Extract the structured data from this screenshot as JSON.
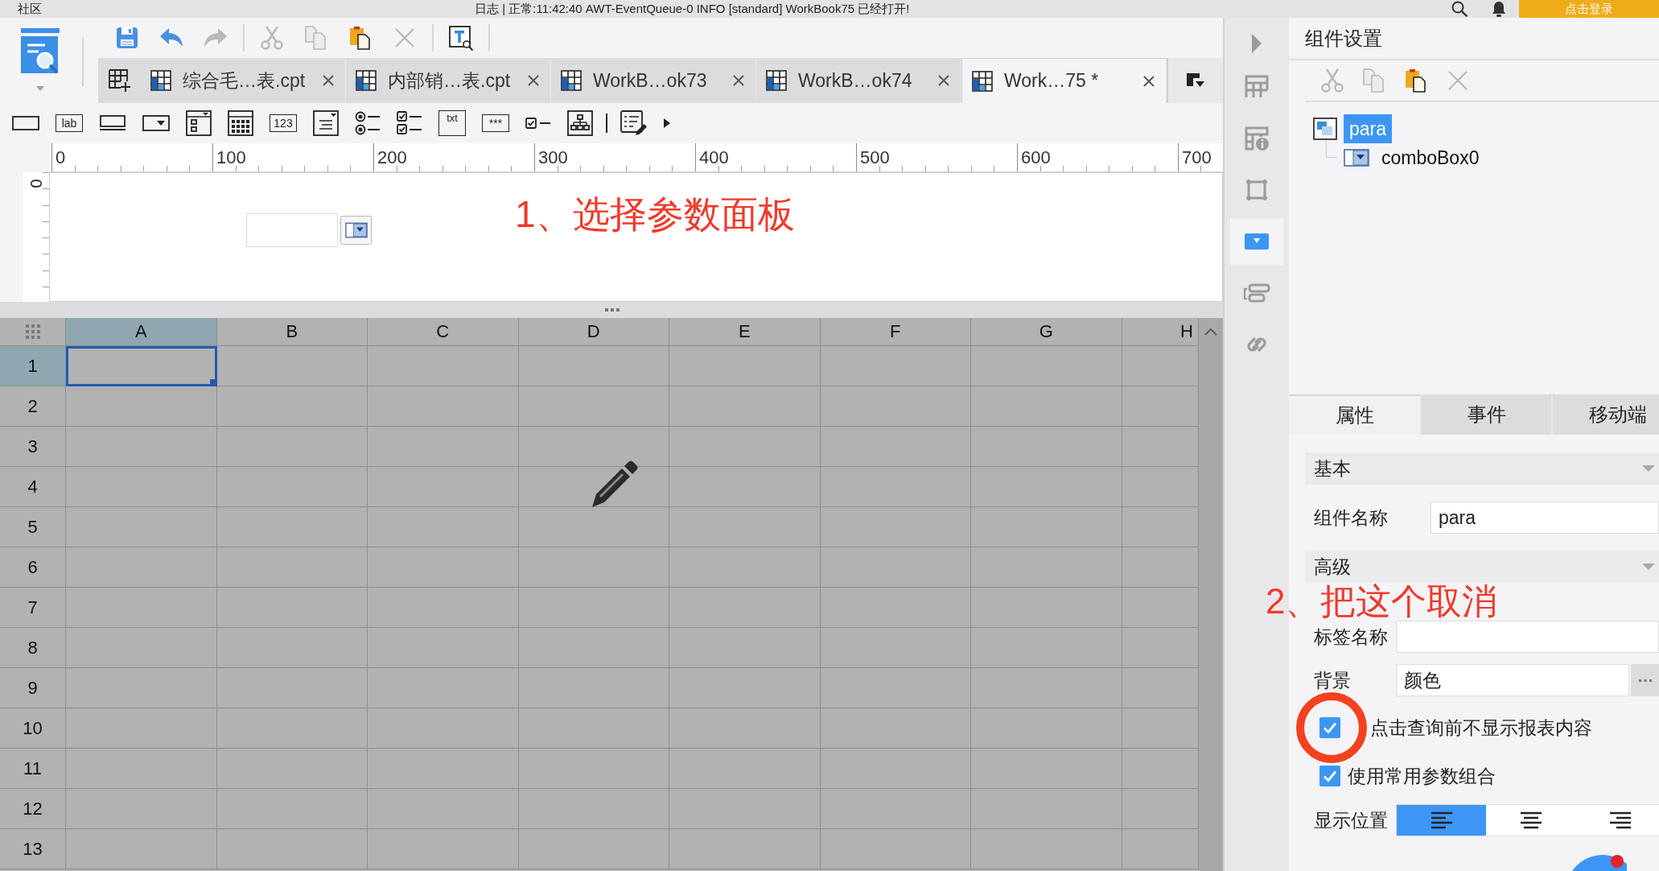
{
  "top_bar": {
    "community": "社区",
    "log_text": "日志 | 正常:11:42:40 AWT-EventQueue-0 INFO [standard] WorkBook75 已经打开!",
    "login_button": "点击登录"
  },
  "toolbar": {
    "groups": [
      [
        {
          "kind": "save",
          "disabled": false
        },
        {
          "kind": "undo",
          "disabled": false
        },
        {
          "kind": "redo",
          "disabled": true
        }
      ],
      [
        {
          "kind": "cut",
          "disabled": true
        },
        {
          "kind": "copy",
          "disabled": true
        },
        {
          "kind": "paste",
          "disabled": false
        },
        {
          "kind": "delete",
          "disabled": true
        }
      ],
      [
        {
          "kind": "text-search",
          "disabled": false
        }
      ]
    ]
  },
  "document_tabs": [
    {
      "label": "综合毛…表.cpt",
      "selected": false
    },
    {
      "label": "内部销…表.cpt",
      "selected": false
    },
    {
      "label": "WorkB…ok73",
      "selected": false
    },
    {
      "label": "WorkB…ok74",
      "selected": false
    },
    {
      "label": "Work…75 *",
      "selected": true
    }
  ],
  "widget_palette": [
    {
      "kind": "button"
    },
    {
      "kind": "label",
      "text": "lab"
    },
    {
      "kind": "text-field"
    },
    {
      "kind": "combo-box"
    },
    {
      "kind": "tree-combo"
    },
    {
      "kind": "date"
    },
    {
      "kind": "number",
      "text": "123"
    },
    {
      "kind": "list"
    },
    {
      "kind": "radio-group"
    },
    {
      "kind": "checkbox-group"
    },
    {
      "kind": "text-area",
      "text": "txt"
    },
    {
      "kind": "password",
      "text": "***"
    },
    {
      "kind": "checkbox"
    },
    {
      "kind": "tree"
    },
    {
      "kind": "separator"
    },
    {
      "kind": "form-edit"
    },
    {
      "kind": "more"
    }
  ],
  "ruler": {
    "horizontal_labels": [
      "0",
      "100",
      "200",
      "300",
      "400",
      "500",
      "600",
      "700"
    ],
    "vertical_label": "0"
  },
  "parameter_panel": {
    "annotation": "1、选择参数面板"
  },
  "sheet": {
    "columns": [
      {
        "label": "A",
        "selected": true
      },
      {
        "label": "B",
        "selected": false
      },
      {
        "label": "C",
        "selected": false
      },
      {
        "label": "D",
        "selected": false
      },
      {
        "label": "E",
        "selected": false
      },
      {
        "label": "F",
        "selected": false
      },
      {
        "label": "G",
        "selected": false
      },
      {
        "label": "H",
        "selected": false
      }
    ],
    "rows": [
      {
        "label": "1",
        "selected": true
      },
      {
        "label": "2",
        "selected": false
      },
      {
        "label": "3",
        "selected": false
      },
      {
        "label": "4",
        "selected": false
      },
      {
        "label": "5",
        "selected": false
      },
      {
        "label": "6",
        "selected": false
      },
      {
        "label": "7",
        "selected": false
      },
      {
        "label": "8",
        "selected": false
      },
      {
        "label": "9",
        "selected": false
      },
      {
        "label": "10",
        "selected": false
      },
      {
        "label": "11",
        "selected": false
      },
      {
        "label": "12",
        "selected": false
      },
      {
        "label": "13",
        "selected": false
      }
    ]
  },
  "side_toolbar": [
    {
      "kind": "table",
      "selected": false
    },
    {
      "kind": "table-info",
      "selected": false
    },
    {
      "kind": "frame",
      "selected": false
    },
    {
      "kind": "widget",
      "selected": true
    },
    {
      "kind": "form-layout",
      "selected": false
    },
    {
      "kind": "link",
      "selected": false
    }
  ],
  "settings_panel": {
    "title": "组件设置",
    "toolbar": [
      {
        "kind": "cut",
        "disabled": true
      },
      {
        "kind": "copy",
        "disabled": true
      },
      {
        "kind": "paste",
        "disabled": false
      },
      {
        "kind": "delete",
        "disabled": true
      }
    ],
    "tree": [
      {
        "label": "para",
        "kind": "panel",
        "selected": true,
        "children": [
          {
            "label": "comboBox0",
            "kind": "combo-box",
            "selected": false
          }
        ]
      }
    ],
    "tabs": [
      {
        "label": "属性",
        "selected": true
      },
      {
        "label": "事件",
        "selected": false
      },
      {
        "label": "移动端",
        "selected": false
      }
    ],
    "sections": [
      {
        "title": "基本",
        "expanded": true,
        "rows": [
          {
            "kind": "text",
            "label": "组件名称",
            "value": "para"
          }
        ]
      },
      {
        "title": "高级",
        "expanded": true,
        "rows": [
          {
            "kind": "text",
            "label": "标签名称"
          },
          {
            "kind": "picker",
            "label": "背景",
            "value": "颜色"
          },
          {
            "kind": "checkbox",
            "label": "点击查询前不显示报表内容",
            "checked": true,
            "circled": true
          },
          {
            "kind": "checkbox",
            "label": "使用常用参数组合",
            "checked": true,
            "circled": false
          },
          {
            "kind": "alignment",
            "label": "显示位置",
            "options": [
              {
                "kind": "left",
                "selected": true
              },
              {
                "kind": "center",
                "selected": false
              },
              {
                "kind": "right",
                "selected": false
              }
            ]
          }
        ]
      }
    ],
    "annotation": "2、把这个取消"
  }
}
